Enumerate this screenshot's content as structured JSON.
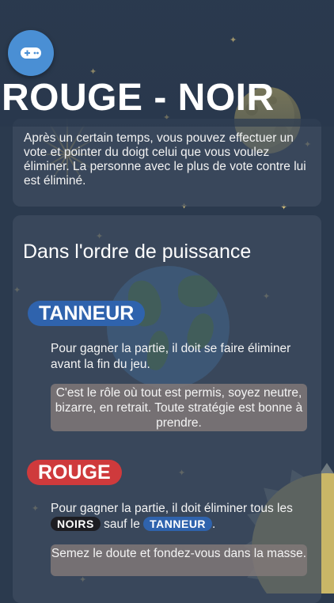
{
  "app": {
    "title": "ROUGE - NOIR",
    "fab_icon": "gamepad-icon"
  },
  "vote_card": {
    "text": "Après un certain temps, vous pouvez effectuer un vote et pointer du doigt celui que vous voulez éliminer. La personne avec le plus de vote contre lui est éliminé."
  },
  "powers": {
    "title": "Dans l'ordre de puissance",
    "roles": [
      {
        "name": "TANNEUR",
        "color": "#2f63ad",
        "description": "Pour gagner la partie, il doit se faire éliminer avant la fin du jeu.",
        "tip": "C'est le rôle où tout est permis, soyez neutre, bizarre, en retrait. Toute stratégie est bonne à prendre."
      },
      {
        "name": "ROUGE",
        "color": "#cf3a3c",
        "description_start": "Pour gagner la partie, il doit éliminer tous les",
        "chip_noirs": "NOIRS",
        "description_middle": "sauf le",
        "chip_tanneur": "TANNEUR",
        "description_end": ".",
        "tip": "Semez le doute et fondez-vous dans la masse."
      }
    ]
  },
  "colors": {
    "background": "#2b3a4e",
    "fab": "#4a8fd4",
    "tanneur": "#2f63ad",
    "rouge": "#cf3a3c",
    "noirs": "#1d1d22"
  }
}
